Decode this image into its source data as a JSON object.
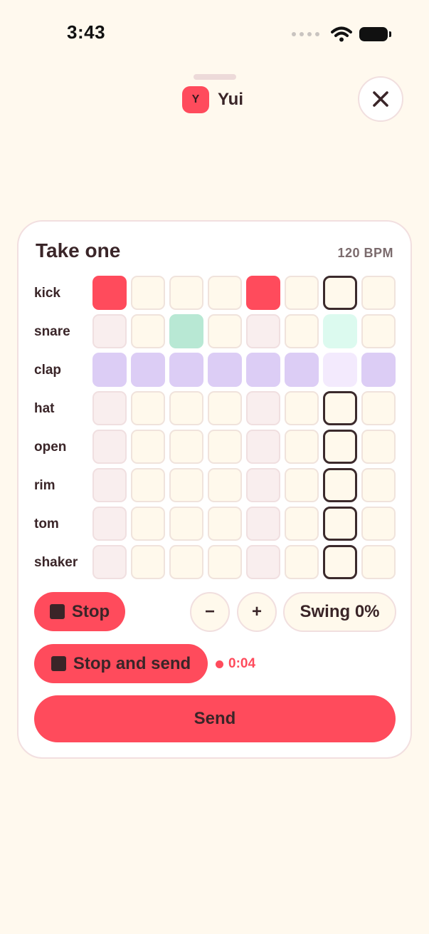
{
  "status_bar": {
    "time": "3:43"
  },
  "header": {
    "avatar_initial": "Y",
    "user_name": "Yui",
    "close_icon": "close-icon"
  },
  "card": {
    "title": "Take one",
    "bpm_label": "120 BPM",
    "steps": 8,
    "playhead_step": 7,
    "rows": [
      {
        "label": "kick",
        "color": "#ff4b5c",
        "active": [
          1,
          0,
          0,
          0,
          1,
          0,
          0,
          0
        ]
      },
      {
        "label": "snare",
        "color": "#b8e8d4",
        "active": [
          0,
          0,
          1,
          0,
          0,
          0,
          1,
          0
        ]
      },
      {
        "label": "clap",
        "color": "#dccdf5",
        "active": [
          1,
          1,
          1,
          1,
          1,
          1,
          1,
          1
        ]
      },
      {
        "label": "hat",
        "color": "#ff4b5c",
        "active": [
          0,
          0,
          0,
          0,
          0,
          0,
          0,
          0
        ]
      },
      {
        "label": "open",
        "color": "#ff4b5c",
        "active": [
          0,
          0,
          0,
          0,
          0,
          0,
          0,
          0
        ]
      },
      {
        "label": "rim",
        "color": "#ff4b5c",
        "active": [
          0,
          0,
          0,
          0,
          0,
          0,
          0,
          0
        ]
      },
      {
        "label": "tom",
        "color": "#ff4b5c",
        "active": [
          0,
          0,
          0,
          0,
          0,
          0,
          0,
          0
        ]
      },
      {
        "label": "shaker",
        "color": "#ff4b5c",
        "active": [
          0,
          0,
          0,
          0,
          0,
          0,
          0,
          0
        ]
      }
    ],
    "playhead_colors": {
      "snare": "#dcfaef",
      "clap": "#f3eafd"
    },
    "controls": {
      "stop_label": "Stop",
      "minus_label": "−",
      "plus_label": "+",
      "swing_label": "Swing 0%",
      "stop_and_send_label": "Stop and send",
      "recording_time": "0:04",
      "send_label": "Send"
    }
  },
  "colors": {
    "accent": "#ff4b5c",
    "background": "#fff9ee",
    "text": "#3a2528"
  }
}
